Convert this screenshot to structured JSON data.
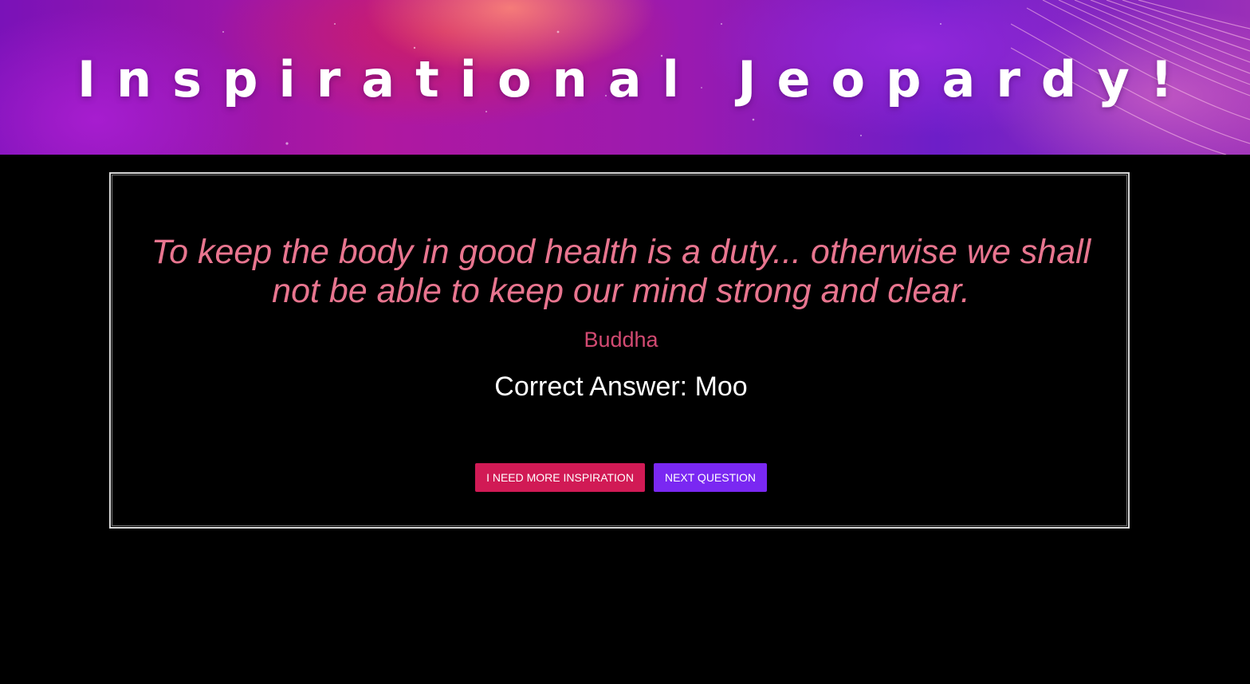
{
  "header": {
    "title": "Inspirational Jeopardy!"
  },
  "card": {
    "quote": "To keep the body in good health is a duty... otherwise we shall not be able to keep our mind strong and clear.",
    "author": "Buddha",
    "correct_answer_label": "Correct Answer:",
    "correct_answer": "Moo",
    "correct_answer_text": "Correct Answer: Moo"
  },
  "buttons": {
    "more_inspiration": "I NEED MORE INSPIRATION",
    "next_question": "NEXT QUESTION"
  },
  "colors": {
    "background": "#000000",
    "quote": "#e8758f",
    "author": "#d24a72",
    "inspire_button": "#d11a55",
    "next_button": "#7a28f2"
  }
}
